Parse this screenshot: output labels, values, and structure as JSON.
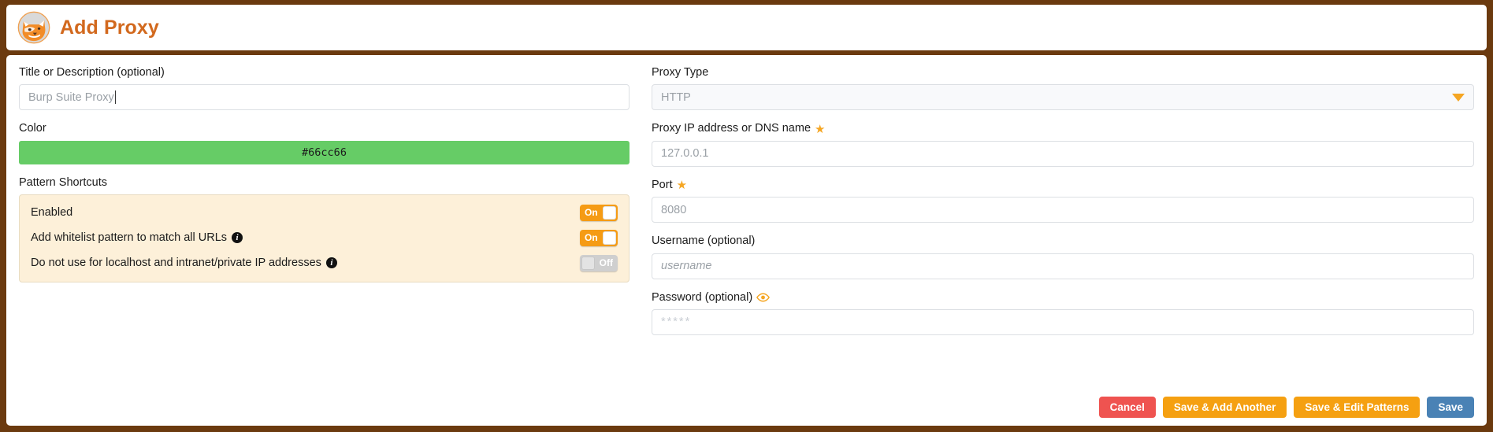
{
  "header": {
    "title": "Add Proxy",
    "logo_icon": "fox-logo-icon"
  },
  "left": {
    "title_field": {
      "label": "Title or Description (optional)",
      "value": "Burp Suite Proxy"
    },
    "color_field": {
      "label": "Color",
      "value": "#66cc66",
      "swatch_color": "#66cc66"
    },
    "pattern_shortcuts": {
      "label": "Pattern Shortcuts",
      "rows": [
        {
          "label": "Enabled",
          "has_info": false,
          "toggle_state": "On"
        },
        {
          "label": "Add whitelist pattern to match all URLs",
          "has_info": true,
          "toggle_state": "On"
        },
        {
          "label": "Do not use for localhost and intranet/private IP addresses",
          "has_info": true,
          "toggle_state": "Off"
        }
      ]
    }
  },
  "right": {
    "proxy_type": {
      "label": "Proxy Type",
      "value": "HTTP"
    },
    "proxy_ip": {
      "label": "Proxy IP address or DNS name",
      "required": true,
      "placeholder": "127.0.0.1"
    },
    "port": {
      "label": "Port",
      "required": true,
      "placeholder": "8080"
    },
    "username": {
      "label": "Username (optional)",
      "placeholder": "username"
    },
    "password": {
      "label": "Password (optional)",
      "placeholder": "*****",
      "reveal_icon": "eye-icon"
    }
  },
  "buttons": {
    "cancel": "Cancel",
    "save_add_another": "Save & Add Another",
    "save_edit_patterns": "Save & Edit Patterns",
    "save": "Save"
  },
  "colors": {
    "window_border": "#6b3a0f",
    "title": "#d2691e",
    "accent_orange": "#f5a623",
    "toggle_on": "#f59b14",
    "toggle_off": "#cfcfcf",
    "panel_bg": "#fdf0d9",
    "cancel": "#ef5350",
    "save": "#4a82b5"
  }
}
